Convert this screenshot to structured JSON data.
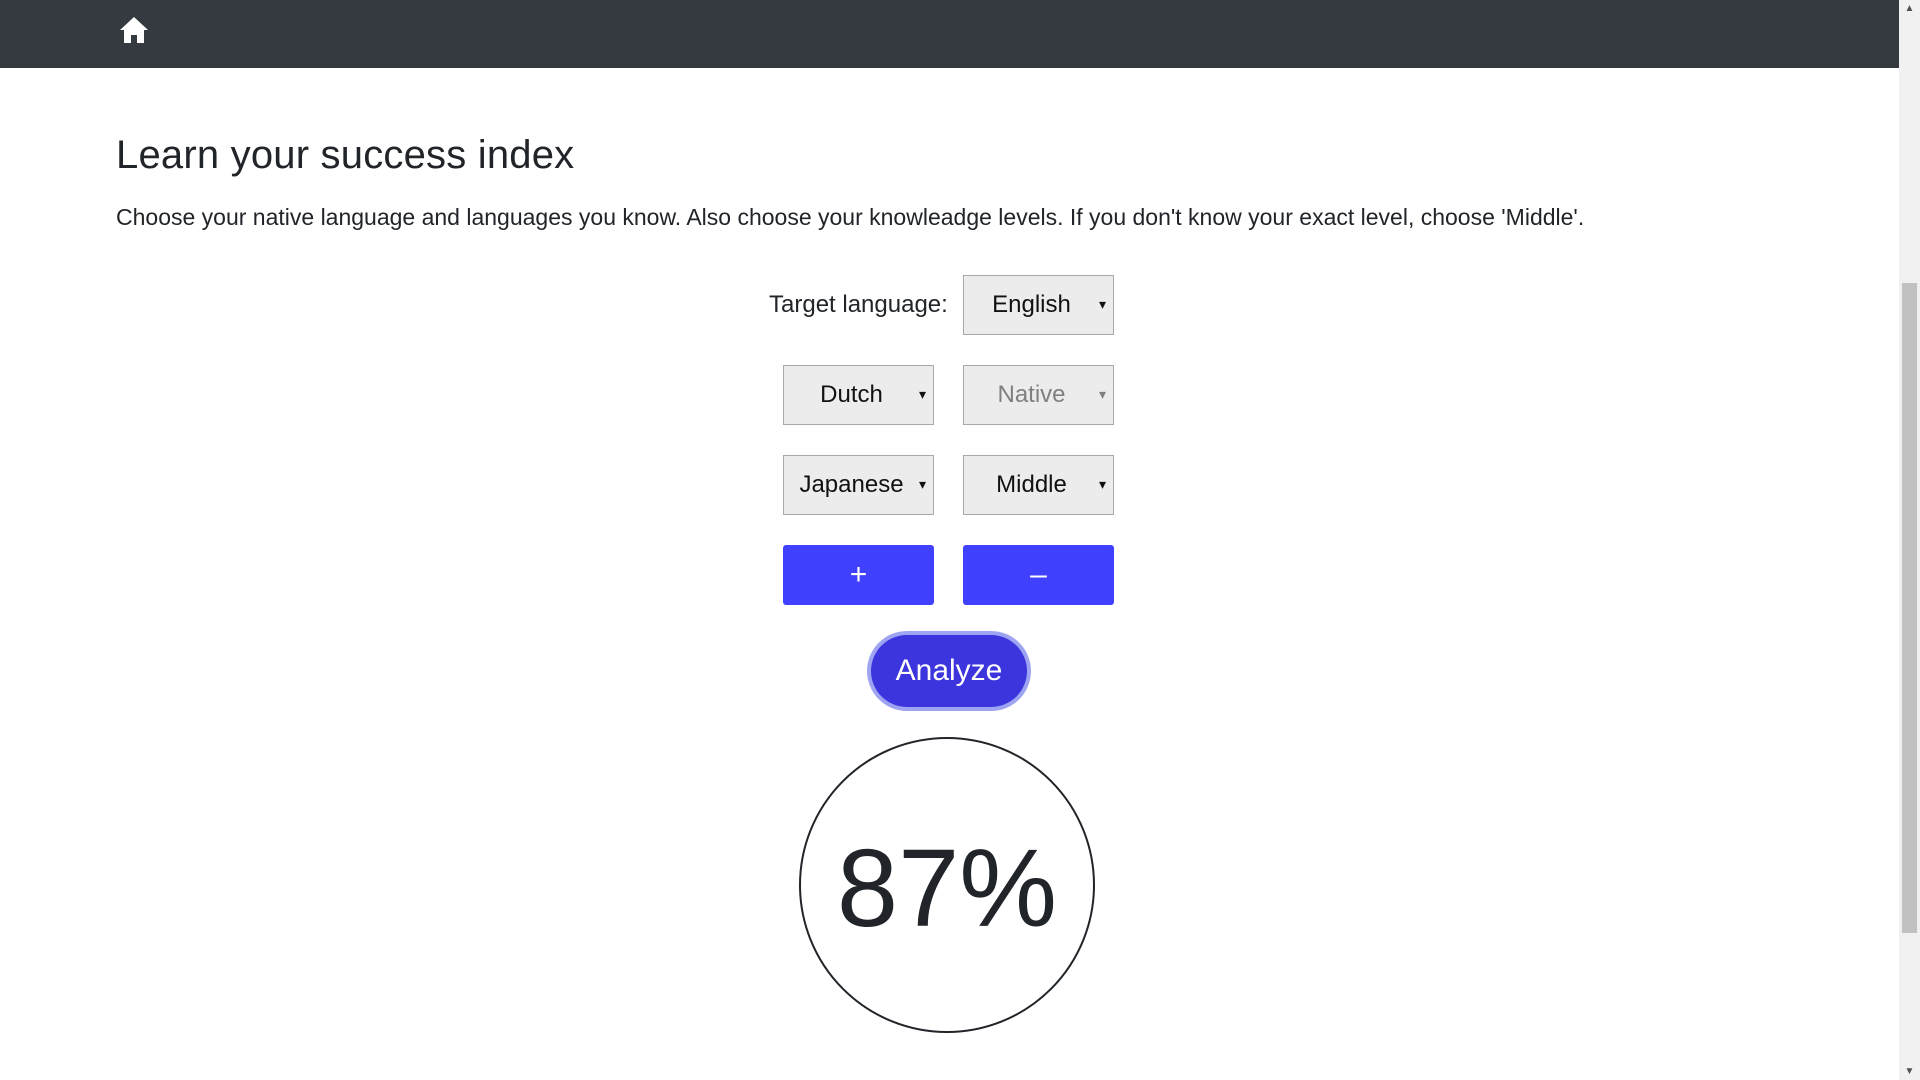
{
  "navbar": {
    "home_icon": "home-icon",
    "background": "#343a40"
  },
  "main": {
    "title": "Learn your success index",
    "description": "Choose your native language and languages you know. Also choose your knowleadge levels. If you don't know your exact level, choose 'Middle'."
  },
  "form": {
    "target_label": "Target language:",
    "target_value": "English",
    "rows": [
      {
        "language": "Dutch",
        "level": "Native",
        "level_disabled": true
      },
      {
        "language": "Japanese",
        "level": "Middle",
        "level_disabled": false
      }
    ],
    "add_label": "+",
    "remove_label": "–",
    "analyze_label": "Analyze",
    "button_color": "#4040ff",
    "analyze_color": "#3c34dd"
  },
  "result": {
    "value": "87%"
  },
  "icons": {
    "dropdown": "▾",
    "scroll_up": "▲",
    "scroll_down": "▼"
  }
}
